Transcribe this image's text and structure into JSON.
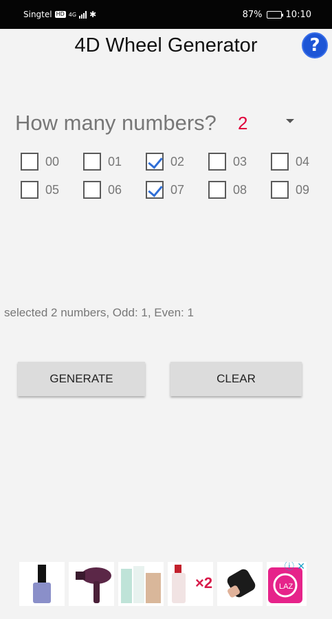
{
  "status_bar": {
    "carrier": "Singtel",
    "network": "4G",
    "battery": "87%",
    "battery_level": 0.87,
    "time": "10:10"
  },
  "app": {
    "title": "4D Wheel Generator",
    "help_label": "?"
  },
  "selector": {
    "question": "How many numbers?",
    "value": "2"
  },
  "numbers": [
    {
      "label": "00",
      "checked": false
    },
    {
      "label": "01",
      "checked": false
    },
    {
      "label": "02",
      "checked": true
    },
    {
      "label": "03",
      "checked": false
    },
    {
      "label": "04",
      "checked": false
    },
    {
      "label": "05",
      "checked": false
    },
    {
      "label": "06",
      "checked": false
    },
    {
      "label": "07",
      "checked": true
    },
    {
      "label": "08",
      "checked": false
    },
    {
      "label": "09",
      "checked": false
    }
  ],
  "summary": "selected 2 numbers, Odd: 1, Even: 1",
  "buttons": {
    "generate": "GENERATE",
    "clear": "CLEAR"
  },
  "ad": {
    "multiplier": "×2",
    "items": [
      "nail-polish",
      "hair-dryer",
      "skincare-set",
      "toner-bottles",
      "lipstick",
      "lazada-logo"
    ]
  }
}
